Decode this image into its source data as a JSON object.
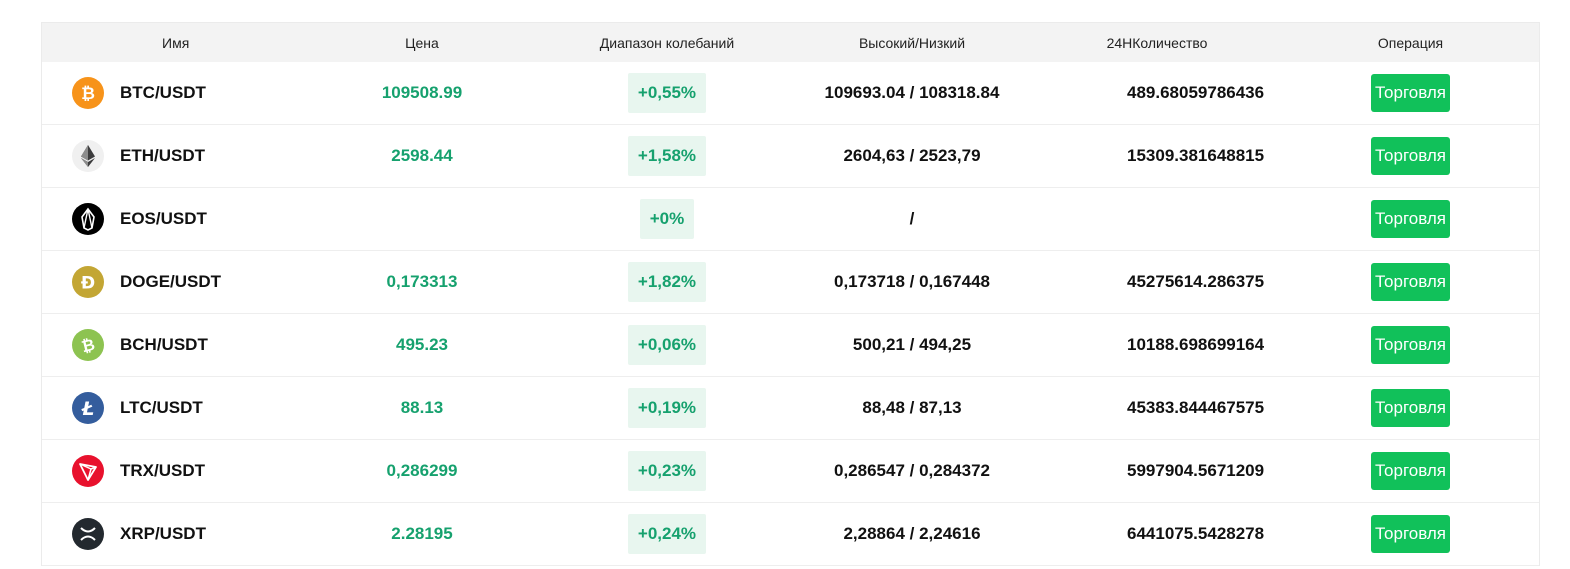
{
  "header": {
    "name": "Имя",
    "price": "Цена",
    "range": "Диапазон колебаний",
    "high_low": "Высокий/Низкий",
    "volume": "24НКоличество",
    "operation": "Операция"
  },
  "colors": {
    "up": "#16a16e",
    "up_bg": "#e8f6ef",
    "button": "#11c15a"
  },
  "rows": [
    {
      "icon": "btc-icon",
      "pair": "BTC/USDT",
      "price": "109508.99",
      "change": "+0,55%",
      "high_low": "109693.04 / 108318.84",
      "volume": "489.68059786436",
      "action": "Торговля"
    },
    {
      "icon": "eth-icon",
      "pair": "ETH/USDT",
      "price": "2598.44",
      "change": "+1,58%",
      "high_low": "2604,63 / 2523,79",
      "volume": "15309.381648815",
      "action": "Торговля"
    },
    {
      "icon": "eos-icon",
      "pair": "EOS/USDT",
      "price": "",
      "change": "+0%",
      "high_low": "/",
      "volume": "",
      "action": "Торговля"
    },
    {
      "icon": "doge-icon",
      "pair": "DOGE/USDT",
      "price": "0,173313",
      "change": "+1,82%",
      "high_low": "0,173718 / 0,167448",
      "volume": "45275614.286375",
      "action": "Торговля"
    },
    {
      "icon": "bch-icon",
      "pair": "BCH/USDT",
      "price": "495.23",
      "change": "+0,06%",
      "high_low": "500,21 / 494,25",
      "volume": "10188.698699164",
      "action": "Торговля"
    },
    {
      "icon": "ltc-icon",
      "pair": "LTC/USDT",
      "price": "88.13",
      "change": "+0,19%",
      "high_low": "88,48 / 87,13",
      "volume": "45383.844467575",
      "action": "Торговля"
    },
    {
      "icon": "trx-icon",
      "pair": "TRX/USDT",
      "price": "0,286299",
      "change": "+0,23%",
      "high_low": "0,286547 / 0,284372",
      "volume": "5997904.5671209",
      "action": "Торговля"
    },
    {
      "icon": "xrp-icon",
      "pair": "XRP/USDT",
      "price": "2.28195",
      "change": "+0,24%",
      "high_low": "2,28864 / 2,24616",
      "volume": "6441075.5428278",
      "action": "Торговля"
    }
  ]
}
